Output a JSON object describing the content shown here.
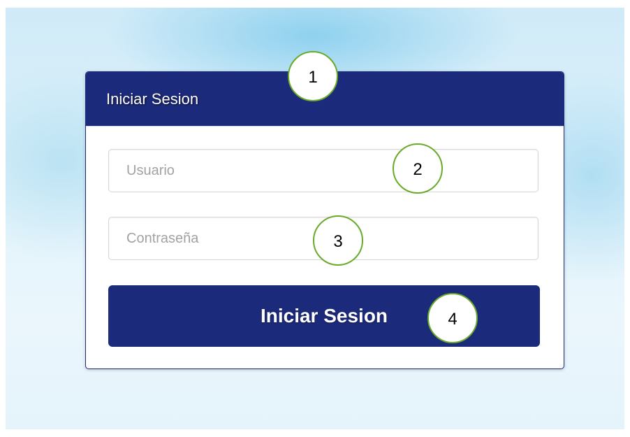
{
  "panel": {
    "title": "Iniciar Sesion"
  },
  "form": {
    "username_placeholder": "Usuario",
    "username_value": "",
    "password_placeholder": "Contraseña",
    "password_value": "",
    "submit_label": "Iniciar Sesion"
  },
  "annotations": [
    "1",
    "2",
    "3",
    "4"
  ],
  "colors": {
    "primary": "#1c2a7b",
    "marker_border": "#6aaa2a"
  }
}
